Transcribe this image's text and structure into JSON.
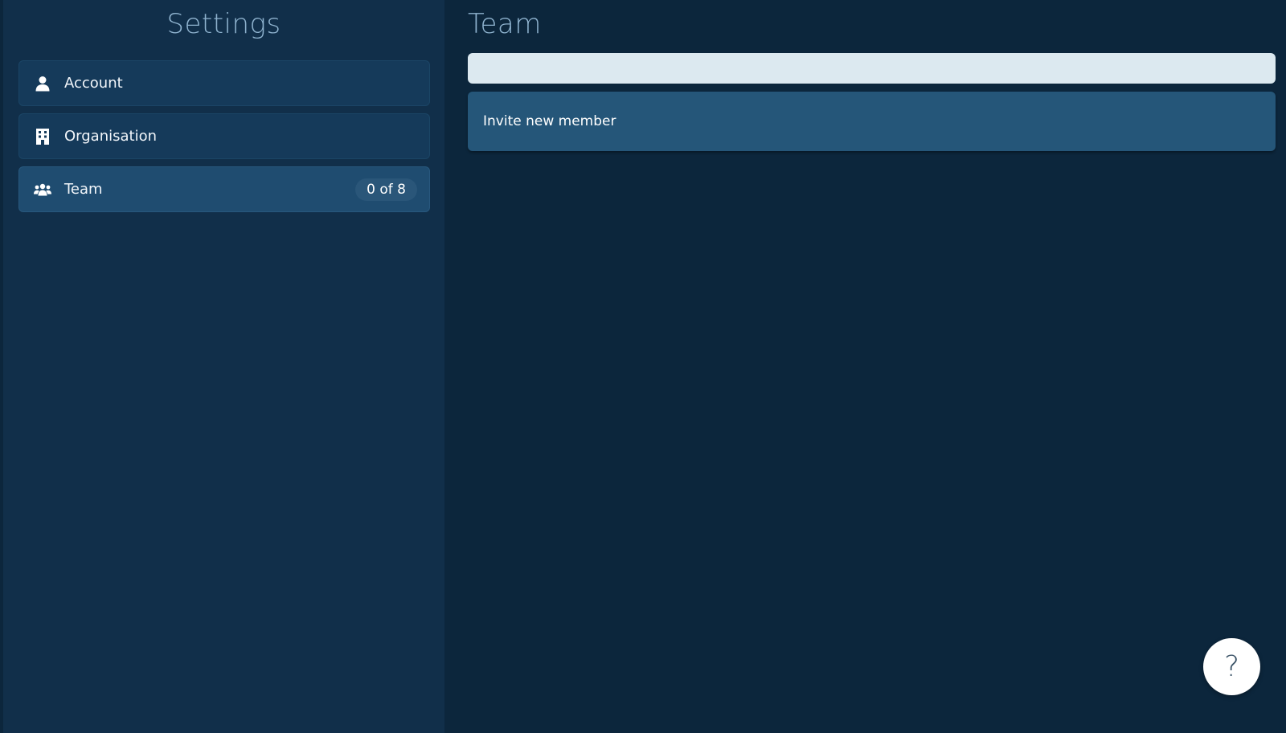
{
  "sidebar": {
    "title": "Settings",
    "items": [
      {
        "label": "Account",
        "icon": "user-icon",
        "active": false
      },
      {
        "label": "Organisation",
        "icon": "building-icon",
        "active": false
      },
      {
        "label": "Team",
        "icon": "users-icon",
        "active": true,
        "badge": "0 of 8"
      }
    ]
  },
  "main": {
    "title": "Team",
    "search": {
      "value": "",
      "placeholder": ""
    },
    "invite_label": "Invite new member"
  },
  "help": {
    "label": "?"
  },
  "colors": {
    "background": "#0c263c",
    "sidebar": "#112f4a",
    "nav_item": "#153a5a",
    "nav_item_active": "#1f4c70",
    "title": "#8fb3cf",
    "input": "#dce9f0",
    "invite_button": "#255679",
    "help_button": "#ffffff"
  }
}
